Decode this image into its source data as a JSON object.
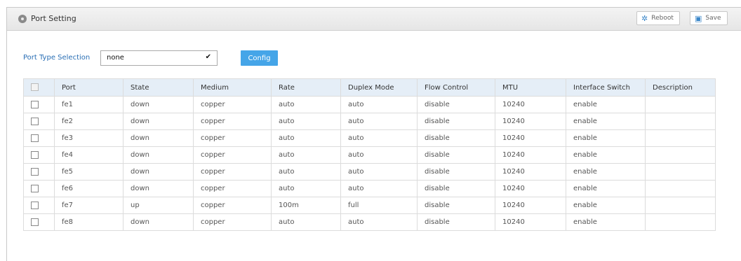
{
  "header": {
    "title": "Port Setting",
    "reboot_label": "Reboot",
    "save_label": "Save",
    "accent": "#3a86c8"
  },
  "toolbar": {
    "port_type_label": "Port Type Selection",
    "port_type_value": "none",
    "config_label": "Config",
    "config_color": "#45a5e8"
  },
  "table": {
    "columns": [
      "Port",
      "State",
      "Medium",
      "Rate",
      "Duplex Mode",
      "Flow Control",
      "MTU",
      "Interface Switch",
      "Description"
    ],
    "rows": [
      {
        "port": "fe1",
        "state": "down",
        "medium": "copper",
        "rate": "auto",
        "duplex": "auto",
        "flow": "disable",
        "mtu": "10240",
        "switch": "enable",
        "description": ""
      },
      {
        "port": "fe2",
        "state": "down",
        "medium": "copper",
        "rate": "auto",
        "duplex": "auto",
        "flow": "disable",
        "mtu": "10240",
        "switch": "enable",
        "description": ""
      },
      {
        "port": "fe3",
        "state": "down",
        "medium": "copper",
        "rate": "auto",
        "duplex": "auto",
        "flow": "disable",
        "mtu": "10240",
        "switch": "enable",
        "description": ""
      },
      {
        "port": "fe4",
        "state": "down",
        "medium": "copper",
        "rate": "auto",
        "duplex": "auto",
        "flow": "disable",
        "mtu": "10240",
        "switch": "enable",
        "description": ""
      },
      {
        "port": "fe5",
        "state": "down",
        "medium": "copper",
        "rate": "auto",
        "duplex": "auto",
        "flow": "disable",
        "mtu": "10240",
        "switch": "enable",
        "description": ""
      },
      {
        "port": "fe6",
        "state": "down",
        "medium": "copper",
        "rate": "auto",
        "duplex": "auto",
        "flow": "disable",
        "mtu": "10240",
        "switch": "enable",
        "description": ""
      },
      {
        "port": "fe7",
        "state": "up",
        "medium": "copper",
        "rate": "100m",
        "duplex": "full",
        "flow": "disable",
        "mtu": "10240",
        "switch": "enable",
        "description": ""
      },
      {
        "port": "fe8",
        "state": "down",
        "medium": "copper",
        "rate": "auto",
        "duplex": "auto",
        "flow": "disable",
        "mtu": "10240",
        "switch": "enable",
        "description": ""
      }
    ]
  }
}
